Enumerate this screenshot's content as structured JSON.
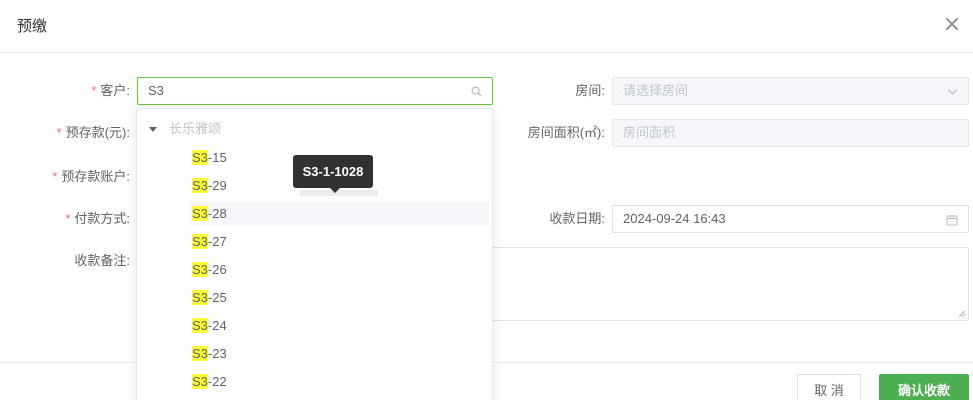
{
  "dialog": {
    "title": "预缴",
    "close_icon": "×"
  },
  "form": {
    "customer": {
      "label": "客户:",
      "value": "S3"
    },
    "prepay_amount": {
      "label": "预存款(元):"
    },
    "prepay_account": {
      "label": "预存款账户:"
    },
    "payment_method": {
      "label": "付款方式:"
    },
    "remark": {
      "label": "收款备注:"
    },
    "room": {
      "label": "房间:",
      "placeholder": "请选择房间"
    },
    "room_area": {
      "label": "房间面积(㎡):",
      "placeholder": "房间面积"
    },
    "receipt_date": {
      "label": "收款日期:",
      "value": "2024-09-24 16:43"
    },
    "required_mark": "*"
  },
  "dropdown": {
    "group": "长乐雅颂",
    "match": "S3",
    "options": [
      "-15",
      "-29",
      "-28",
      "-27",
      "-26",
      "-25",
      "-24",
      "-23",
      "-22"
    ]
  },
  "tooltip": {
    "text": "S3-1-1028"
  },
  "footer": {
    "cancel_label": "取 消",
    "confirm_label": "确认收款"
  },
  "colors": {
    "required": "#f56c6c",
    "primary": "#4caf50",
    "active_border": "#67c23a",
    "highlight": "#ffff33"
  }
}
